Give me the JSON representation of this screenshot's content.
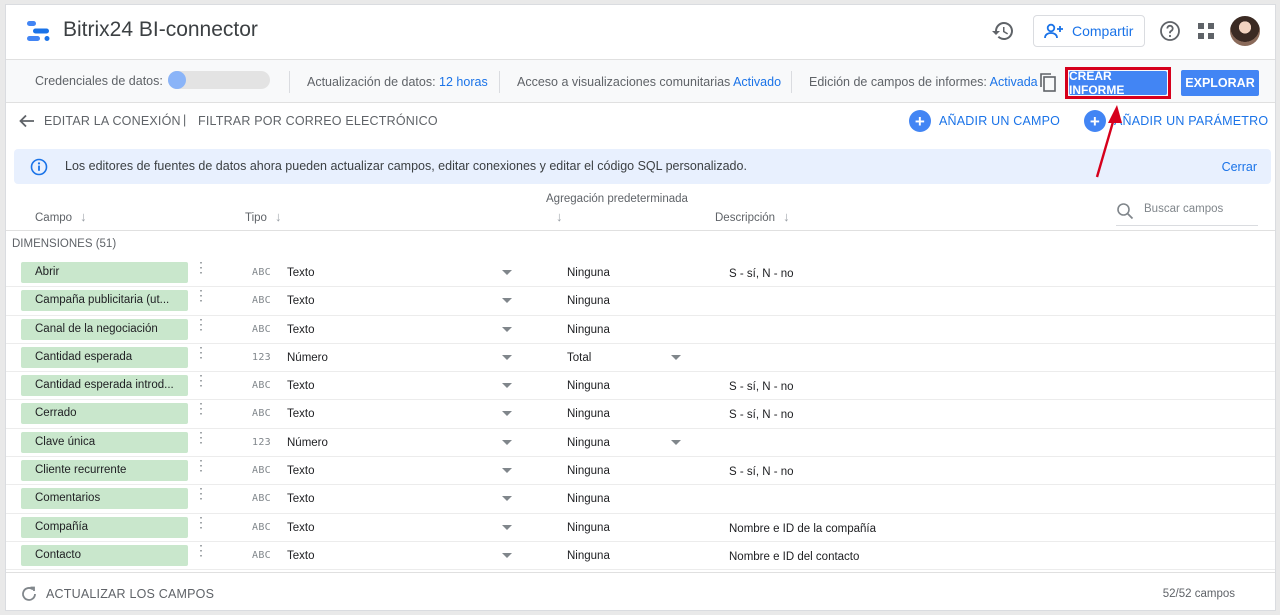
{
  "header": {
    "title": "Bitrix24 BI-connector",
    "share_label": "Compartir"
  },
  "toolbar": {
    "credentials_label": "Credenciales de datos:",
    "update_label": "Actualización de datos:",
    "update_value": "12 horas",
    "community_label": "Acceso a visualizaciones comunitarias",
    "community_value": "Activado",
    "report_edit_label": "Edición de campos de informes:",
    "report_edit_value": "Activada",
    "create_report": "CREAR INFORME",
    "explore": "EXPLORAR"
  },
  "editbar": {
    "edit_connection": "EDITAR LA CONEXIÓN",
    "separator": "|",
    "filter_email": "FILTRAR POR CORREO ELECTRÓNICO",
    "add_field": "AÑADIR UN CAMPO",
    "add_parameter": "AÑADIR UN PARÁMETRO"
  },
  "banner": {
    "text": "Los editores de fuentes de datos ahora pueden actualizar campos, editar conexiones y editar el código SQL personalizado.",
    "close": "Cerrar"
  },
  "table": {
    "columns": {
      "field": "Campo",
      "type": "Tipo",
      "aggregation": "Agregación predeterminada",
      "description": "Descripción"
    },
    "search_placeholder": "Buscar campos",
    "section": "DIMENSIONES (51)",
    "rows": [
      {
        "field": "Abrir",
        "type_icon": "ABC",
        "type": "Texto",
        "aggregation": "Ninguna",
        "description": "S - sí, N - no"
      },
      {
        "field": "Campaña publicitaria (ut...",
        "type_icon": "ABC",
        "type": "Texto",
        "aggregation": "Ninguna",
        "description": ""
      },
      {
        "field": "Canal de la negociación",
        "type_icon": "ABC",
        "type": "Texto",
        "aggregation": "Ninguna",
        "description": ""
      },
      {
        "field": "Cantidad esperada",
        "type_icon": "123",
        "type": "Número",
        "aggregation": "Total",
        "description": ""
      },
      {
        "field": "Cantidad esperada introd...",
        "type_icon": "ABC",
        "type": "Texto",
        "aggregation": "Ninguna",
        "description": "S - sí, N - no"
      },
      {
        "field": "Cerrado",
        "type_icon": "ABC",
        "type": "Texto",
        "aggregation": "Ninguna",
        "description": "S - sí, N - no"
      },
      {
        "field": "Clave única",
        "type_icon": "123",
        "type": "Número",
        "aggregation": "Ninguna",
        "description": ""
      },
      {
        "field": "Cliente recurrente",
        "type_icon": "ABC",
        "type": "Texto",
        "aggregation": "Ninguna",
        "description": "S - sí, N - no"
      },
      {
        "field": "Comentarios",
        "type_icon": "ABC",
        "type": "Texto",
        "aggregation": "Ninguna",
        "description": ""
      },
      {
        "field": "Compañía",
        "type_icon": "ABC",
        "type": "Texto",
        "aggregation": "Ninguna",
        "description": "Nombre e ID de la compañía"
      },
      {
        "field": "Contacto",
        "type_icon": "ABC",
        "type": "Texto",
        "aggregation": "Ninguna",
        "description": "Nombre e ID del contacto"
      }
    ]
  },
  "footer": {
    "refresh": "ACTUALIZAR LOS CAMPOS",
    "count": "52/52 campos"
  },
  "colors": {
    "accent": "#4285f4",
    "link": "#1a73e8",
    "field_chip": "#c9e7cc",
    "highlight": "#d6001c"
  }
}
